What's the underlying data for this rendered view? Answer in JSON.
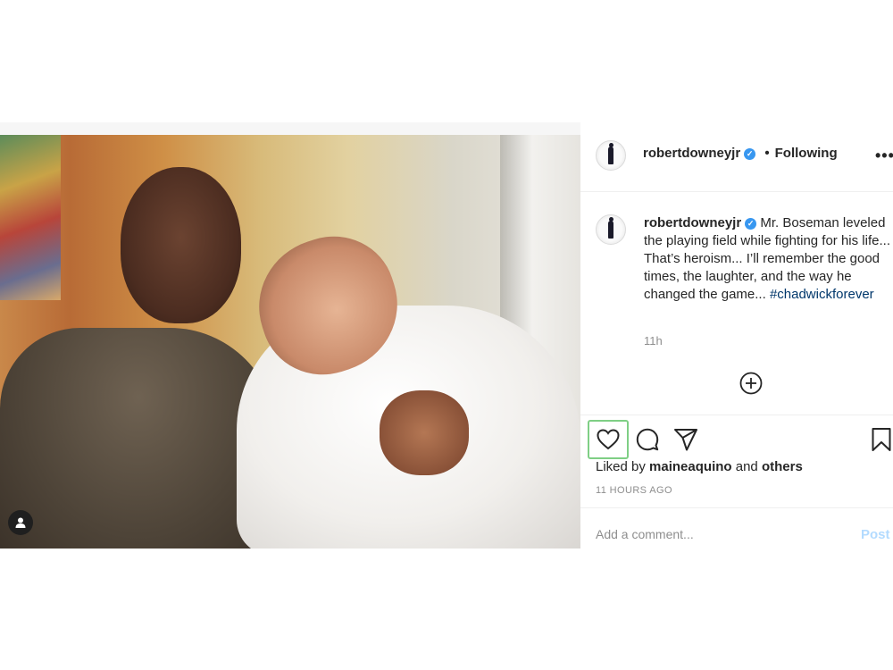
{
  "post": {
    "username": "robertdowneyjr",
    "verified_mark": "✓",
    "follow_separator": "•",
    "follow_status": "Following",
    "more_icon": "more-options-icon",
    "caption_username": "robertdowneyjr",
    "caption_text": "Mr. Boseman leveled the playing field while fighting for his life... That’s heroism... I’ll remember the good times, the laughter, and the way he changed the game...",
    "hashtag": "#chadwickforever",
    "caption_time": "11h",
    "load_more_icon": "plus-circle-icon"
  },
  "actions": {
    "icons": [
      "heart-icon",
      "comment-icon",
      "share-icon",
      "bookmark-icon"
    ]
  },
  "likes": {
    "prefix": "Liked by",
    "user": "maineaquino",
    "conjunction": "and",
    "others": "others"
  },
  "timestamp": "11 HOURS AGO",
  "comment": {
    "placeholder": "Add a comment...",
    "post_label": "Post"
  },
  "colors": {
    "link": "#00376b",
    "verified": "#3897f0",
    "muted": "#8e8e8e",
    "post_disabled": "#b3dbff",
    "like_highlight": "#7fcf85"
  }
}
